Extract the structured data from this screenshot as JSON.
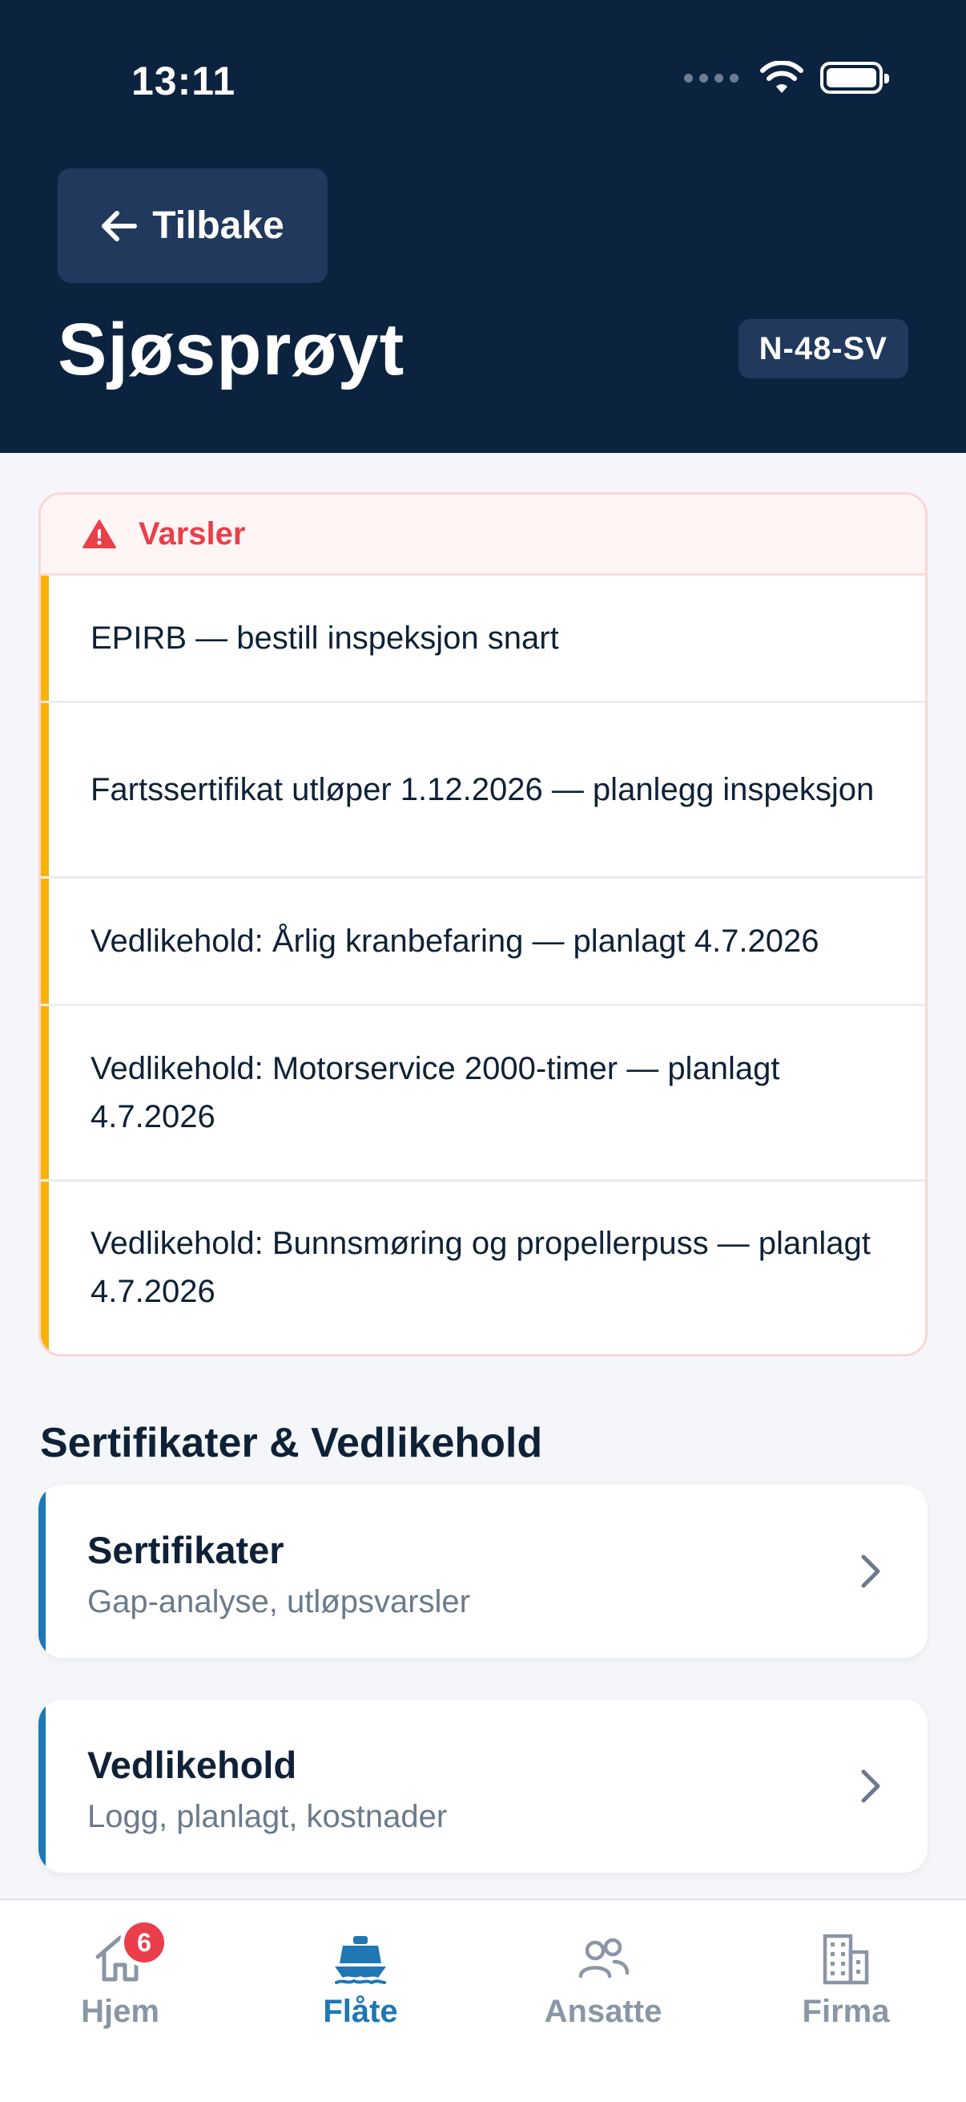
{
  "status_bar": {
    "time": "13:11"
  },
  "header": {
    "back_label": "Tilbake",
    "title": "Sjøsprøyt",
    "registration": "N-48-SV"
  },
  "alerts": {
    "title": "Varsler",
    "items": [
      {
        "text": "EPIRB — bestill inspeksjon snart"
      },
      {
        "text": "Fartssertifikat utløper 1.12.2026 — planlegg inspeksjon"
      },
      {
        "text": "Vedlikehold: Årlig kranbefaring — planlagt 4.7.2026"
      },
      {
        "text": "Vedlikehold: Motorservice 2000-timer — planlagt 4.7.2026"
      },
      {
        "text": "Vedlikehold: Bunnsmøring og propellerpuss — planlagt 4.7.2026"
      }
    ]
  },
  "section": {
    "title": "Sertifikater & Vedlikehold",
    "cards": [
      {
        "title": "Sertifikater",
        "subtitle": "Gap-analyse, utløpsvarsler"
      },
      {
        "title": "Vedlikehold",
        "subtitle": "Logg, planlagt, kostnader"
      }
    ]
  },
  "tabbar": {
    "tabs": [
      {
        "label": "Hjem",
        "icon": "home-icon",
        "badge": "6"
      },
      {
        "label": "Flåte",
        "icon": "boat-icon",
        "active": true
      },
      {
        "label": "Ansatte",
        "icon": "people-icon"
      },
      {
        "label": "Firma",
        "icon": "building-icon"
      }
    ]
  },
  "colors": {
    "header_bg": "#0c2340",
    "alert_red": "#ea3f4b",
    "warning_yellow": "#f8b400",
    "accent_blue": "#1f77b4"
  }
}
